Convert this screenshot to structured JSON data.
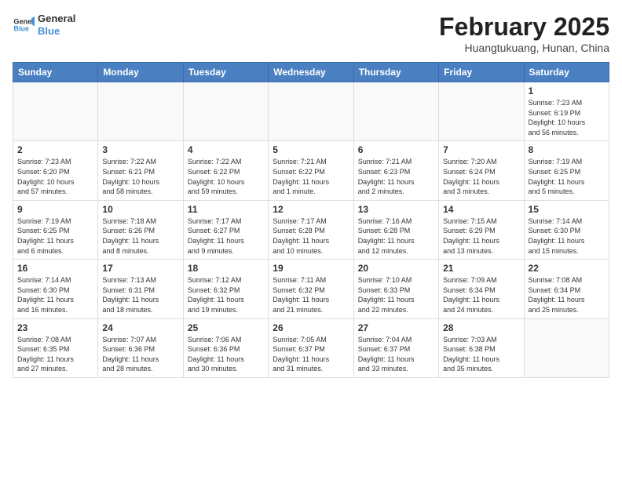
{
  "logo": {
    "line1": "General",
    "line2": "Blue"
  },
  "title": "February 2025",
  "location": "Huangtukuang, Hunan, China",
  "days_of_week": [
    "Sunday",
    "Monday",
    "Tuesday",
    "Wednesday",
    "Thursday",
    "Friday",
    "Saturday"
  ],
  "weeks": [
    [
      {
        "day": "",
        "info": ""
      },
      {
        "day": "",
        "info": ""
      },
      {
        "day": "",
        "info": ""
      },
      {
        "day": "",
        "info": ""
      },
      {
        "day": "",
        "info": ""
      },
      {
        "day": "",
        "info": ""
      },
      {
        "day": "1",
        "info": "Sunrise: 7:23 AM\nSunset: 6:19 PM\nDaylight: 10 hours\nand 56 minutes."
      }
    ],
    [
      {
        "day": "2",
        "info": "Sunrise: 7:23 AM\nSunset: 6:20 PM\nDaylight: 10 hours\nand 57 minutes."
      },
      {
        "day": "3",
        "info": "Sunrise: 7:22 AM\nSunset: 6:21 PM\nDaylight: 10 hours\nand 58 minutes."
      },
      {
        "day": "4",
        "info": "Sunrise: 7:22 AM\nSunset: 6:22 PM\nDaylight: 10 hours\nand 59 minutes."
      },
      {
        "day": "5",
        "info": "Sunrise: 7:21 AM\nSunset: 6:22 PM\nDaylight: 11 hours\nand 1 minute."
      },
      {
        "day": "6",
        "info": "Sunrise: 7:21 AM\nSunset: 6:23 PM\nDaylight: 11 hours\nand 2 minutes."
      },
      {
        "day": "7",
        "info": "Sunrise: 7:20 AM\nSunset: 6:24 PM\nDaylight: 11 hours\nand 3 minutes."
      },
      {
        "day": "8",
        "info": "Sunrise: 7:19 AM\nSunset: 6:25 PM\nDaylight: 11 hours\nand 5 minutes."
      }
    ],
    [
      {
        "day": "9",
        "info": "Sunrise: 7:19 AM\nSunset: 6:25 PM\nDaylight: 11 hours\nand 6 minutes."
      },
      {
        "day": "10",
        "info": "Sunrise: 7:18 AM\nSunset: 6:26 PM\nDaylight: 11 hours\nand 8 minutes."
      },
      {
        "day": "11",
        "info": "Sunrise: 7:17 AM\nSunset: 6:27 PM\nDaylight: 11 hours\nand 9 minutes."
      },
      {
        "day": "12",
        "info": "Sunrise: 7:17 AM\nSunset: 6:28 PM\nDaylight: 11 hours\nand 10 minutes."
      },
      {
        "day": "13",
        "info": "Sunrise: 7:16 AM\nSunset: 6:28 PM\nDaylight: 11 hours\nand 12 minutes."
      },
      {
        "day": "14",
        "info": "Sunrise: 7:15 AM\nSunset: 6:29 PM\nDaylight: 11 hours\nand 13 minutes."
      },
      {
        "day": "15",
        "info": "Sunrise: 7:14 AM\nSunset: 6:30 PM\nDaylight: 11 hours\nand 15 minutes."
      }
    ],
    [
      {
        "day": "16",
        "info": "Sunrise: 7:14 AM\nSunset: 6:30 PM\nDaylight: 11 hours\nand 16 minutes."
      },
      {
        "day": "17",
        "info": "Sunrise: 7:13 AM\nSunset: 6:31 PM\nDaylight: 11 hours\nand 18 minutes."
      },
      {
        "day": "18",
        "info": "Sunrise: 7:12 AM\nSunset: 6:32 PM\nDaylight: 11 hours\nand 19 minutes."
      },
      {
        "day": "19",
        "info": "Sunrise: 7:11 AM\nSunset: 6:32 PM\nDaylight: 11 hours\nand 21 minutes."
      },
      {
        "day": "20",
        "info": "Sunrise: 7:10 AM\nSunset: 6:33 PM\nDaylight: 11 hours\nand 22 minutes."
      },
      {
        "day": "21",
        "info": "Sunrise: 7:09 AM\nSunset: 6:34 PM\nDaylight: 11 hours\nand 24 minutes."
      },
      {
        "day": "22",
        "info": "Sunrise: 7:08 AM\nSunset: 6:34 PM\nDaylight: 11 hours\nand 25 minutes."
      }
    ],
    [
      {
        "day": "23",
        "info": "Sunrise: 7:08 AM\nSunset: 6:35 PM\nDaylight: 11 hours\nand 27 minutes."
      },
      {
        "day": "24",
        "info": "Sunrise: 7:07 AM\nSunset: 6:36 PM\nDaylight: 11 hours\nand 28 minutes."
      },
      {
        "day": "25",
        "info": "Sunrise: 7:06 AM\nSunset: 6:36 PM\nDaylight: 11 hours\nand 30 minutes."
      },
      {
        "day": "26",
        "info": "Sunrise: 7:05 AM\nSunset: 6:37 PM\nDaylight: 11 hours\nand 31 minutes."
      },
      {
        "day": "27",
        "info": "Sunrise: 7:04 AM\nSunset: 6:37 PM\nDaylight: 11 hours\nand 33 minutes."
      },
      {
        "day": "28",
        "info": "Sunrise: 7:03 AM\nSunset: 6:38 PM\nDaylight: 11 hours\nand 35 minutes."
      },
      {
        "day": "",
        "info": ""
      }
    ]
  ]
}
